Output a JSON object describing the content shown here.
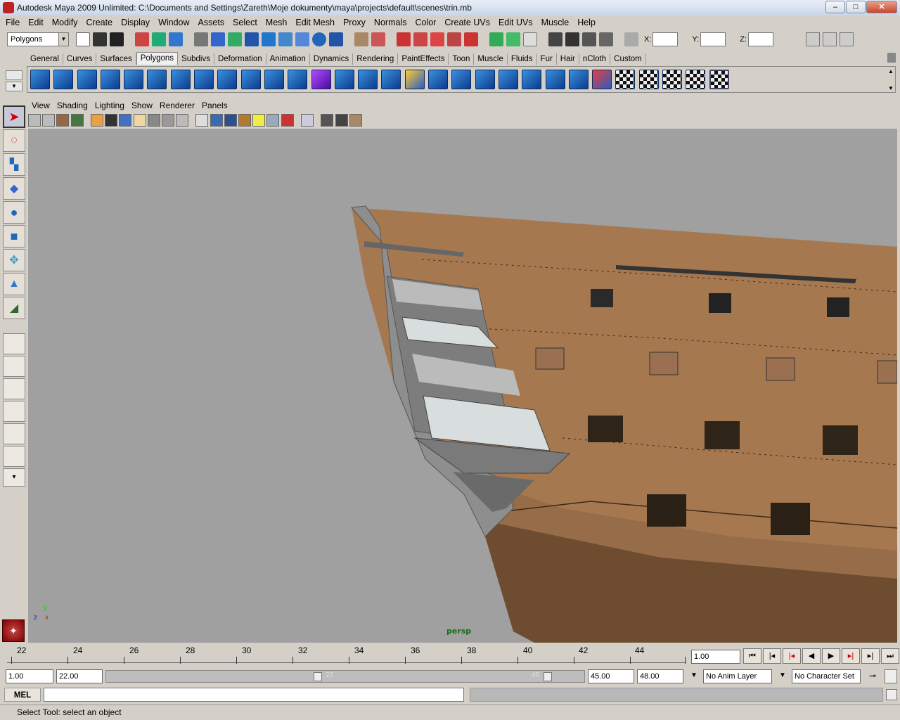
{
  "window": {
    "title": "Autodesk Maya 2009 Unlimited: C:\\Documents and Settings\\Zareth\\Moje dokumenty\\maya\\projects\\default\\scenes\\trin.mb",
    "min_label": "–",
    "max_label": "□",
    "close_label": "✕"
  },
  "menubar": [
    "File",
    "Edit",
    "Modify",
    "Create",
    "Display",
    "Window",
    "Assets",
    "Select",
    "Mesh",
    "Edit Mesh",
    "Proxy",
    "Normals",
    "Color",
    "Create UVs",
    "Edit UVs",
    "Muscle",
    "Help"
  ],
  "status_line": {
    "mode": "Polygons",
    "x_label": "X:",
    "y_label": "Y:",
    "z_label": "Z:"
  },
  "shelf": {
    "tabs": [
      "General",
      "Curves",
      "Surfaces",
      "Polygons",
      "Subdivs",
      "Deformation",
      "Animation",
      "Dynamics",
      "Rendering",
      "PaintEffects",
      "Toon",
      "Muscle",
      "Fluids",
      "Fur",
      "Hair",
      "nCloth",
      "Custom"
    ],
    "active_tab": "Polygons",
    "icon_count": 30
  },
  "panel": {
    "menus": [
      "View",
      "Shading",
      "Lighting",
      "Show",
      "Renderer",
      "Panels"
    ],
    "camera": "persp",
    "axis_x": "x",
    "axis_y": "y",
    "axis_z": "z"
  },
  "timeline": {
    "ticks": [
      "22",
      "24",
      "26",
      "28",
      "30",
      "32",
      "34",
      "36",
      "38",
      "40",
      "42",
      "44"
    ],
    "current_frame": "1.00"
  },
  "range": {
    "start": "1.00",
    "playback_start": "22.00",
    "slider_left_label": "22",
    "slider_right_label": "45",
    "playback_end": "45.00",
    "end": "48.00",
    "anim_layer": "No Anim Layer",
    "character_set": "No Character Set"
  },
  "command": {
    "label": "MEL"
  },
  "help": {
    "text": "Select Tool: select an object"
  },
  "colors": {
    "viewport_bg": "#a0a0a0",
    "hull": "#a57850",
    "stern_gray": "#8e8e8e",
    "camera_label": "#1a6a1a"
  }
}
